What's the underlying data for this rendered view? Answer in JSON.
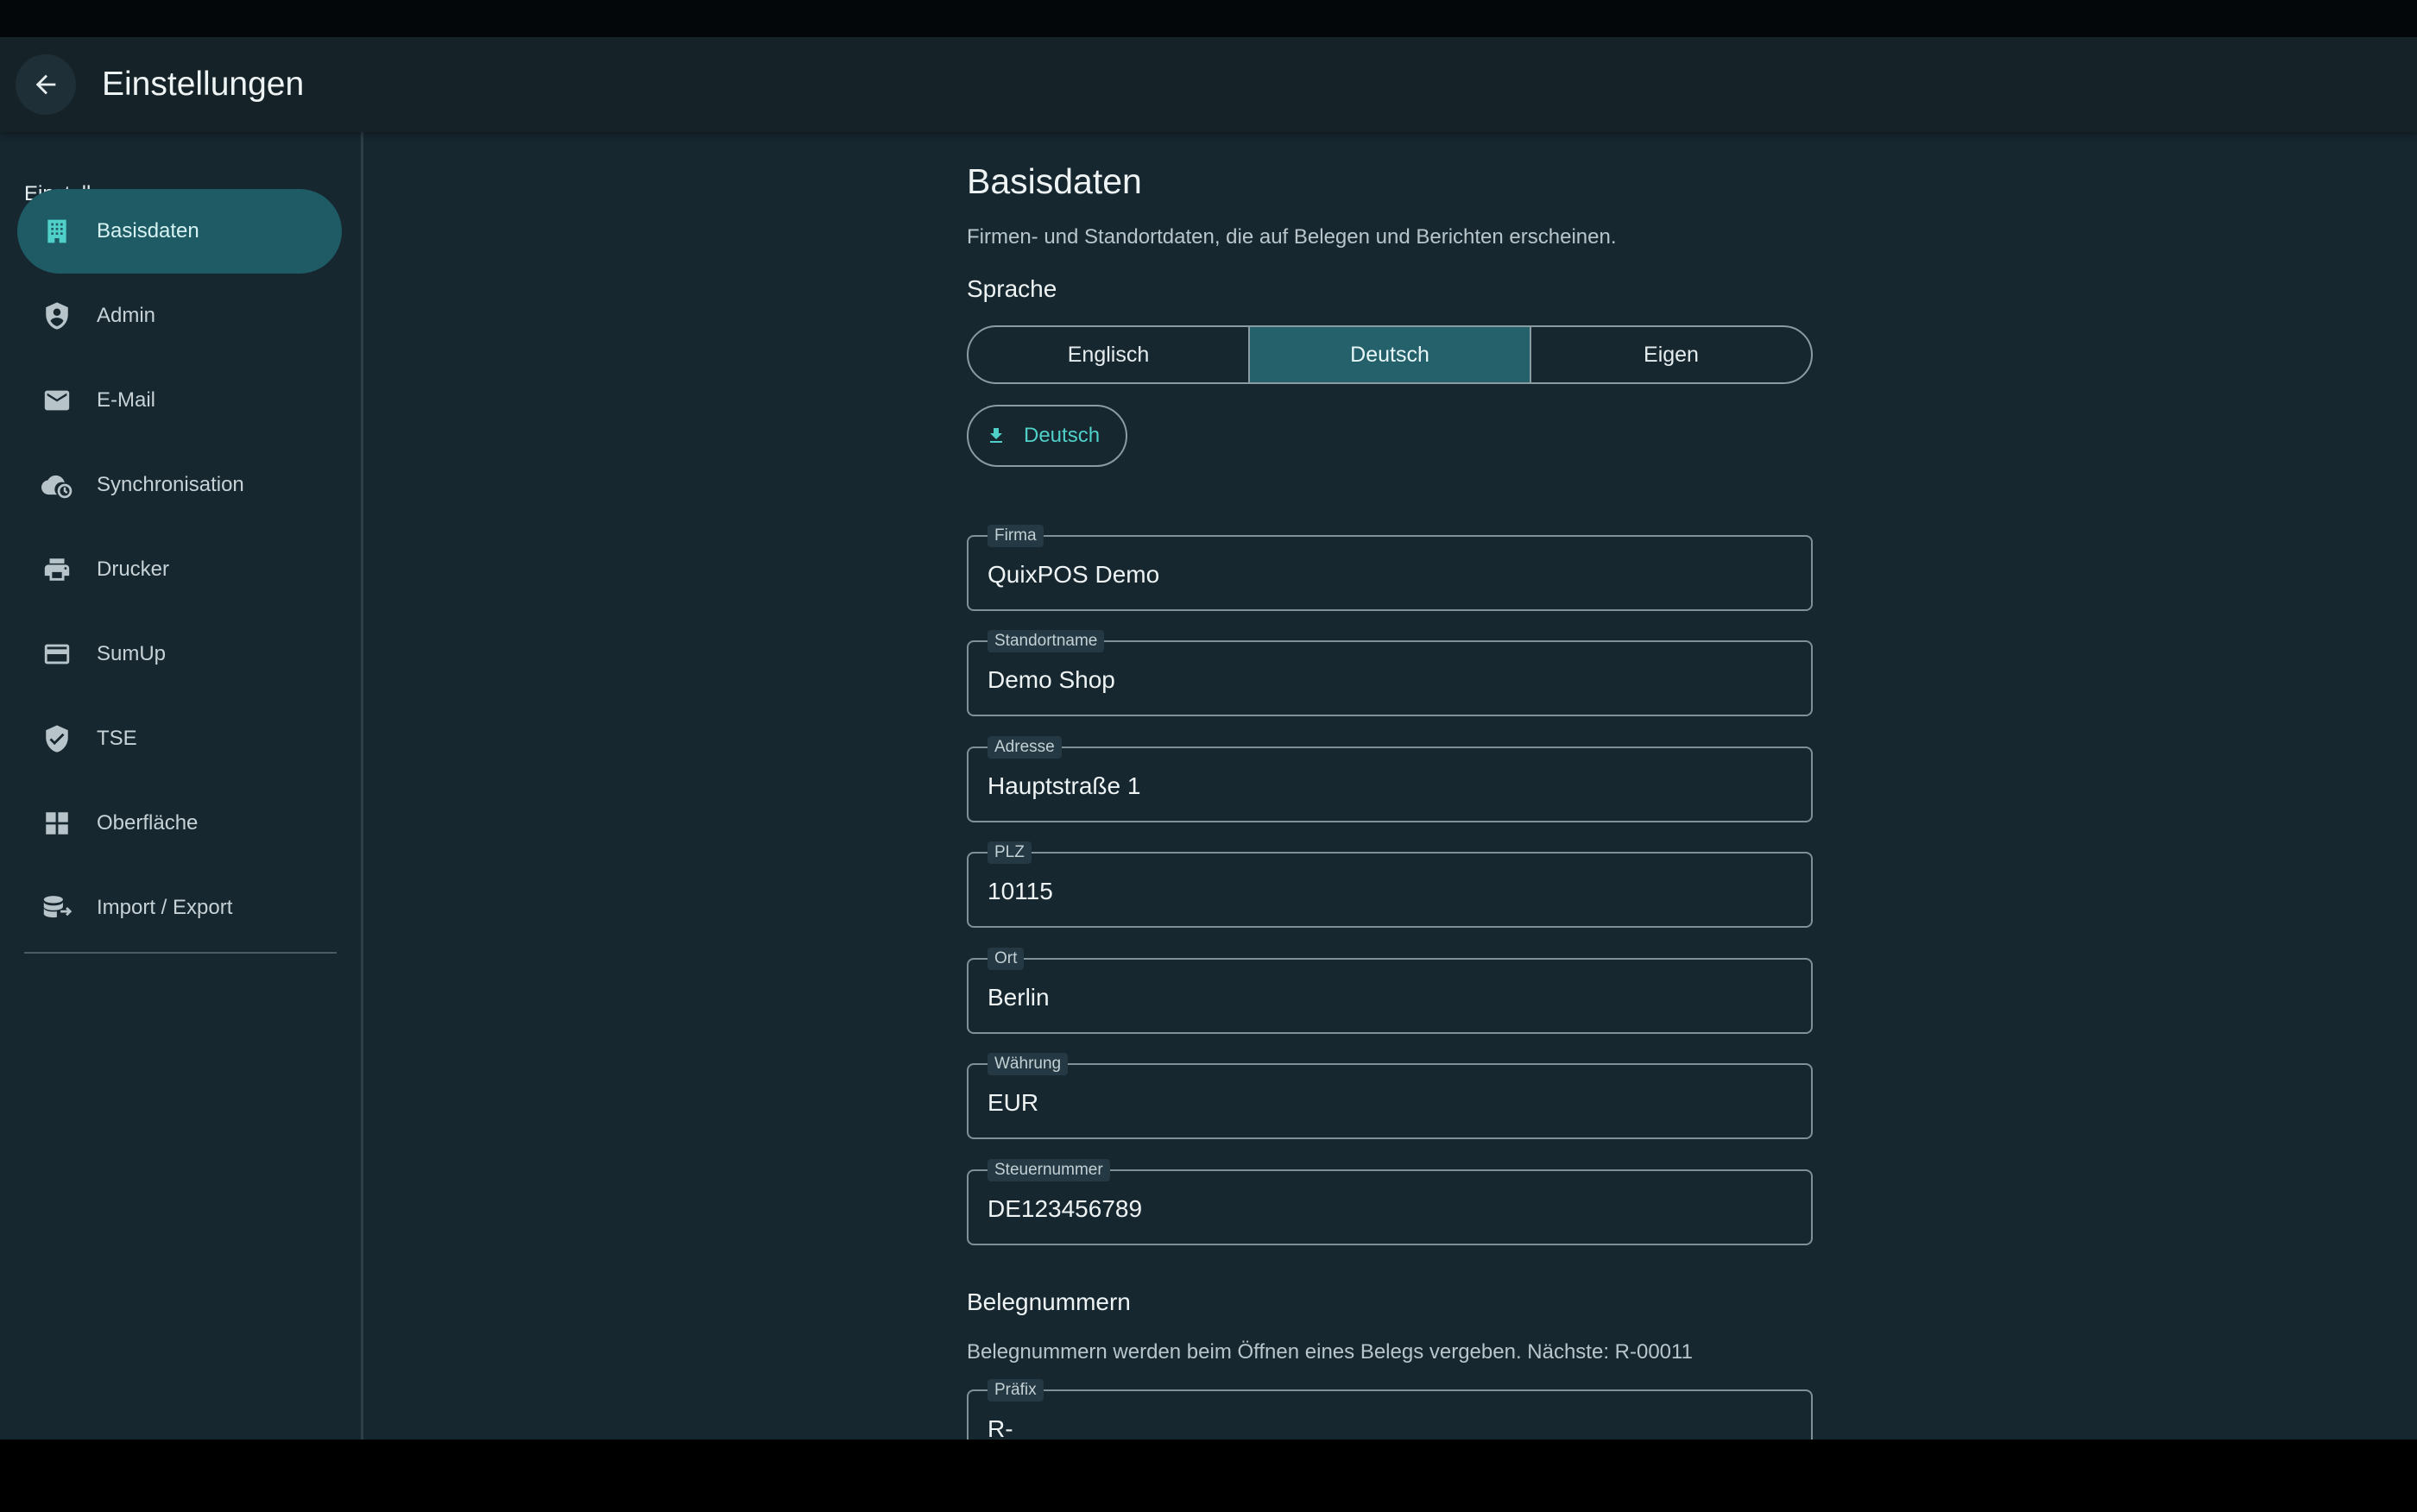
{
  "header": {
    "title": "Einstellungen"
  },
  "sidebar": {
    "heading": "Einstellungen",
    "items": [
      {
        "label": "Basisdaten",
        "icon": "building-icon",
        "active": true
      },
      {
        "label": "Admin",
        "icon": "shield-person-icon",
        "active": false
      },
      {
        "label": "E-Mail",
        "icon": "mail-icon",
        "active": false
      },
      {
        "label": "Synchronisation",
        "icon": "cloud-sync-icon",
        "active": false
      },
      {
        "label": "Drucker",
        "icon": "printer-icon",
        "active": false
      },
      {
        "label": "SumUp",
        "icon": "credit-card-icon",
        "active": false
      },
      {
        "label": "TSE",
        "icon": "shield-check-icon",
        "active": false
      },
      {
        "label": "Oberfläche",
        "icon": "grid-icon",
        "active": false
      },
      {
        "label": "Import / Export",
        "icon": "database-import-icon",
        "active": false
      }
    ]
  },
  "main": {
    "title": "Basisdaten",
    "subtitle": "Firmen- und Standortdaten, die auf Belegen und Berichten erscheinen.",
    "language": {
      "heading": "Sprache",
      "options": [
        "Englisch",
        "Deutsch",
        "Eigen"
      ],
      "selected": "Deutsch",
      "download_label": "Deutsch"
    },
    "fields": [
      {
        "label": "Firma",
        "value": "QuixPOS Demo"
      },
      {
        "label": "Standortname",
        "value": "Demo Shop"
      },
      {
        "label": "Adresse",
        "value": "Hauptstraße 1"
      },
      {
        "label": "PLZ",
        "value": "10115"
      },
      {
        "label": "Ort",
        "value": "Berlin"
      },
      {
        "label": "Währung",
        "value": "EUR"
      },
      {
        "label": "Steuernummer",
        "value": "DE123456789"
      }
    ],
    "receipts": {
      "heading": "Belegnummern",
      "description": "Belegnummern werden beim Öffnen eines Belegs vergeben. Nächste: R-00011",
      "prefix_field": {
        "label": "Präfix",
        "value": "R-"
      }
    }
  },
  "colors": {
    "background": "#172730",
    "appbar": "#152329",
    "accent": "#1e5b64",
    "accent_text": "#4fd0c8"
  }
}
